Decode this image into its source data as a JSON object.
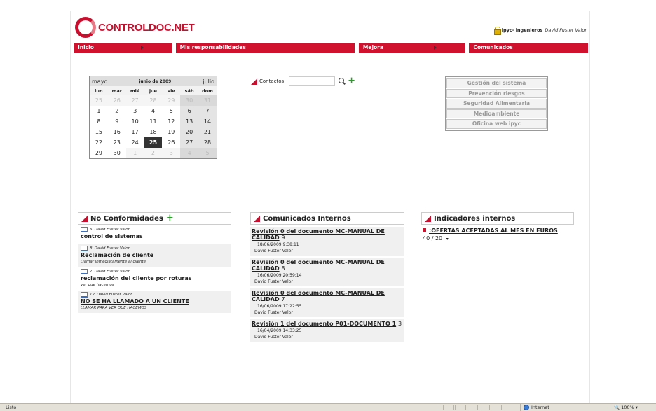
{
  "header": {
    "logo_text": "CONTROLDOC.NET",
    "org": "ipyc- ingenieros",
    "user": "David Fuster Valor"
  },
  "nav": [
    {
      "label": "Inicio"
    },
    {
      "label": "Mis responsabilidades"
    },
    {
      "label": "Mejora"
    },
    {
      "label": "Comunicados"
    }
  ],
  "calendar": {
    "prev_month": "mayo",
    "title": "junio de 2009",
    "next_month": "julio",
    "weekdays": [
      "lun",
      "mar",
      "mié",
      "jue",
      "vie",
      "sáb",
      "dom"
    ],
    "weeks": [
      [
        "25",
        "26",
        "27",
        "28",
        "29",
        "30",
        "31"
      ],
      [
        "1",
        "2",
        "3",
        "4",
        "5",
        "6",
        "7"
      ],
      [
        "8",
        "9",
        "10",
        "11",
        "12",
        "13",
        "14"
      ],
      [
        "15",
        "16",
        "17",
        "18",
        "19",
        "20",
        "21"
      ],
      [
        "22",
        "23",
        "24",
        "25",
        "26",
        "27",
        "28"
      ],
      [
        "29",
        "30",
        "1",
        "2",
        "3",
        "4",
        "5"
      ]
    ],
    "today": "25"
  },
  "contacts": {
    "label": "Contactos",
    "value": ""
  },
  "side_menu": [
    "Gestión del sistema",
    "Prevención riesgos",
    "Seguridad Alimentaria",
    "Medioambiente",
    "Oficina web ipyc"
  ],
  "no_conformidades": {
    "title": "No Conformidades",
    "items": [
      {
        "num": "6",
        "author": "David Fuster Valor",
        "title": "control de sistemas",
        "desc": ""
      },
      {
        "num": "8",
        "author": "David Fuster Valor",
        "title": "Reclamación de cliente",
        "desc": "Llamar inmediatamente al cliente"
      },
      {
        "num": "7",
        "author": "David Fuster Valor",
        "title": "reclamación del cliente por roturas",
        "desc": "ver que hacemos"
      },
      {
        "num": "12",
        "author": "David Fuster Valor",
        "title": "NO SE HA LLAMADO A UN CLIENTE",
        "desc": "LLAMAR PARA VER QUE HACEMOS"
      }
    ]
  },
  "comunicados": {
    "title": "Comunicados Internos",
    "items": [
      {
        "title": "Revisión 0 del documento MC-MANUAL DE CALIDAD",
        "num": "9",
        "date": "18/06/2009 9:38:11",
        "author": "David Fuster Valor"
      },
      {
        "title": "Revisión 0 del documento MC-MANUAL DE CALIDAD",
        "num": "8",
        "date": "16/06/2009 20:59:14",
        "author": "David Fuster Valor"
      },
      {
        "title": "Revisión 0 del documento MC-MANUAL DE CALIDAD",
        "num": "7",
        "date": "16/06/2009 17:22:55",
        "author": "David Fuster Valor"
      },
      {
        "title": "Revisión 1 del documento P01-DOCUMENTO 1",
        "num": "3",
        "date": "16/04/2009 14:33:25",
        "author": "David Fuster Valor"
      }
    ]
  },
  "indicadores": {
    "title": "Indicadores internos",
    "items": [
      {
        "name": ":OFERTAS ACEPTADAS AL MES EN EUROS",
        "value": "40 / 20"
      }
    ]
  },
  "status": {
    "left": "Listo",
    "zone": "Internet",
    "zoom": "100%"
  }
}
